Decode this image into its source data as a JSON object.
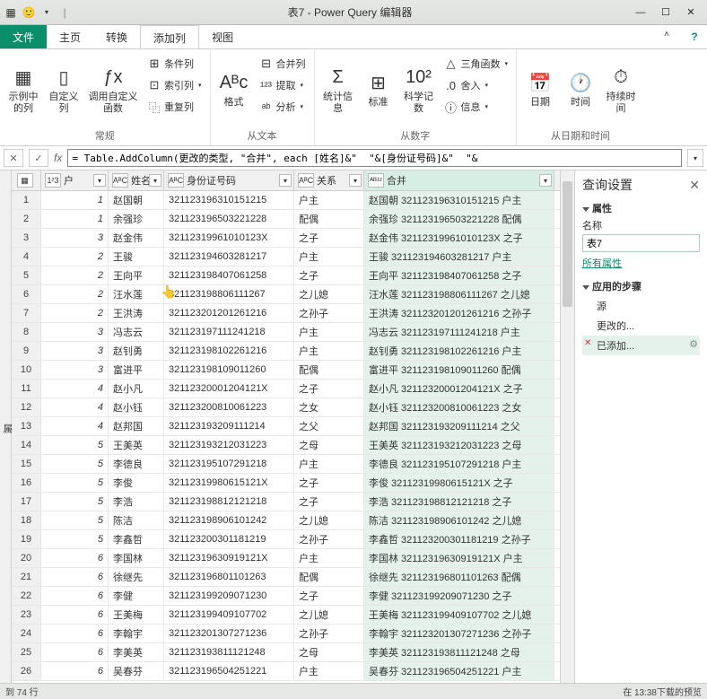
{
  "title": "表7 - Power Query 编辑器",
  "menu": {
    "file": "文件",
    "home": "主页",
    "transform": "转换",
    "addcol": "添加列",
    "view": "视图"
  },
  "ribbon": {
    "g1": {
      "label": "常规",
      "examples": "示例中的列",
      "custom": "自定义列",
      "invoke": "调用自定义函数",
      "cond": "条件列",
      "index": "索引列",
      "dup": "重复列"
    },
    "g2": {
      "label": "从文本",
      "format": "格式",
      "merge": "合并列",
      "extract": "提取",
      "parse": "分析"
    },
    "g3": {
      "label": "从数字",
      "stats": "统计信息",
      "standard": "标准",
      "sci": "科学记数",
      "trig": "三角函数",
      "round": "舍入",
      "info": "信息"
    },
    "g4": {
      "label": "从日期和时间",
      "date": "日期",
      "time": "时间",
      "dur": "持续时间"
    }
  },
  "formula": "= Table.AddColumn(更改的类型, \"合并\", each [姓名]&\"  \"&[身份证号码]&\"  \"&",
  "leftgutter": "属",
  "headers": {
    "hu": "户",
    "name": "姓名",
    "id": "身份证号码",
    "rel": "关系",
    "merge": "合并",
    "typenum": "1²3",
    "typetxt": "AᴮC"
  },
  "rows": [
    {
      "hu": "1",
      "name": "赵国朝",
      "id": "321123196310151215",
      "rel": "户主",
      "merge": "赵国朝 321123196310151215 户主"
    },
    {
      "hu": "1",
      "name": "余强珍",
      "id": "321123196503221228",
      "rel": "配偶",
      "merge": "余强珍 321123196503221228 配偶"
    },
    {
      "hu": "3",
      "name": "赵金伟",
      "id": "32112319961010123X",
      "rel": "之子",
      "merge": "赵金伟 32112319961010123X 之子"
    },
    {
      "hu": "2",
      "name": "王骏",
      "id": "321123194603281217",
      "rel": "户主",
      "merge": "王骏 321123194603281217 户主"
    },
    {
      "hu": "2",
      "name": "王向平",
      "id": "321123198407061258",
      "rel": "之子",
      "merge": "王向平 321123198407061258 之子"
    },
    {
      "hu": "2",
      "name": "汪水莲",
      "id": "321123198806111267",
      "rel": "之儿媳",
      "merge": "汪水莲 321123198806111267 之儿媳"
    },
    {
      "hu": "2",
      "name": "王洪涛",
      "id": "321123201201261216",
      "rel": "之孙子",
      "merge": "王洪涛 321123201201261216 之孙子"
    },
    {
      "hu": "3",
      "name": "冯志云",
      "id": "321123197111241218",
      "rel": "户主",
      "merge": "冯志云 321123197111241218 户主"
    },
    {
      "hu": "3",
      "name": "赵钊勇",
      "id": "321123198102261216",
      "rel": "户主",
      "merge": "赵钊勇 321123198102261216 户主"
    },
    {
      "hu": "3",
      "name": "富进平",
      "id": "321123198109011260",
      "rel": "配偶",
      "merge": "富进平 321123198109011260 配偶"
    },
    {
      "hu": "4",
      "name": "赵小凡",
      "id": "32112320001204121X",
      "rel": "之子",
      "merge": "赵小凡 32112320001204121X 之子"
    },
    {
      "hu": "4",
      "name": "赵小钰",
      "id": "321123200810061223",
      "rel": "之女",
      "merge": "赵小钰 321123200810061223 之女"
    },
    {
      "hu": "4",
      "name": "赵邦国",
      "id": "321123193209111214",
      "rel": "之父",
      "merge": "赵邦国 321123193209111214 之父"
    },
    {
      "hu": "5",
      "name": "王美英",
      "id": "321123193212031223",
      "rel": "之母",
      "merge": "王美英 321123193212031223 之母"
    },
    {
      "hu": "5",
      "name": "李德良",
      "id": "321123195107291218",
      "rel": "户主",
      "merge": "李德良 321123195107291218 户主"
    },
    {
      "hu": "5",
      "name": "李俊",
      "id": "32112319980615121X",
      "rel": "之子",
      "merge": "李俊 32112319980615121X 之子"
    },
    {
      "hu": "5",
      "name": "李浩",
      "id": "321123198812121218",
      "rel": "之子",
      "merge": "李浩 321123198812121218 之子"
    },
    {
      "hu": "5",
      "name": "陈洁",
      "id": "321123198906101242",
      "rel": "之儿媳",
      "merge": "陈洁 321123198906101242 之儿媳"
    },
    {
      "hu": "5",
      "name": "李鑫哲",
      "id": "321123200301181219",
      "rel": "之孙子",
      "merge": "李鑫哲 321123200301181219 之孙子"
    },
    {
      "hu": "6",
      "name": "李国林",
      "id": "32112319630919121X",
      "rel": "户主",
      "merge": "李国林 32112319630919121X 户主"
    },
    {
      "hu": "6",
      "name": "徐继先",
      "id": "321123196801101263",
      "rel": "配偶",
      "merge": "徐继先 321123196801101263 配偶"
    },
    {
      "hu": "6",
      "name": "李健",
      "id": "321123199209071230",
      "rel": "之子",
      "merge": "李健 321123199209071230 之子"
    },
    {
      "hu": "6",
      "name": "王美梅",
      "id": "321123199409107702",
      "rel": "之儿媳",
      "merge": "王美梅 321123199409107702 之儿媳"
    },
    {
      "hu": "6",
      "name": "李翰宇",
      "id": "321123201307271236",
      "rel": "之孙子",
      "merge": "李翰宇 321123201307271236 之孙子"
    },
    {
      "hu": "6",
      "name": "李美英",
      "id": "321123193811121248",
      "rel": "之母",
      "merge": "李美英 321123193811121248 之母"
    },
    {
      "hu": "6",
      "name": "吴春芬",
      "id": "321123196504251221",
      "rel": "户主",
      "merge": "吴春芬 321123196504251221 户主"
    }
  ],
  "settings": {
    "title": "查询设置",
    "props": "属性",
    "namelabel": "名称",
    "namevalue": "表7",
    "allprops": "所有属性",
    "steps_title": "应用的步骤",
    "steps": [
      "源",
      "更改的...",
      "已添加..."
    ]
  },
  "status_left": "到  74 行",
  "status_right": "在 13:38下载的预览"
}
